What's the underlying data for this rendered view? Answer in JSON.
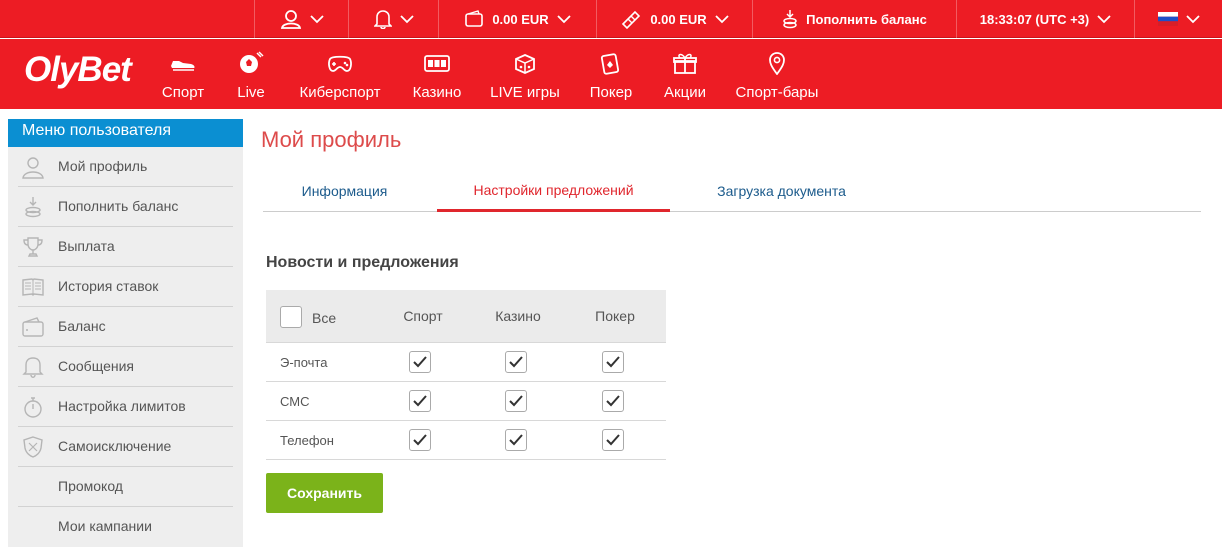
{
  "topbar": {
    "balance": "0.00 EUR",
    "bonus": "0.00 EUR",
    "deposit": "Пополнить баланс",
    "time": "18:33:07 (UTC +3)"
  },
  "brand": {
    "logo": "OlyBet",
    "accent": "#ed1c24"
  },
  "nav": [
    {
      "label": "Спорт",
      "icon": "sport-shoe-icon"
    },
    {
      "label": "Live",
      "icon": "live-ball-icon"
    },
    {
      "label": "Киберспорт",
      "icon": "gamepad-icon"
    },
    {
      "label": "Казино",
      "icon": "slot-machine-icon"
    },
    {
      "label": "LIVE игры",
      "icon": "dice-icon"
    },
    {
      "label": "Покер",
      "icon": "cards-icon"
    },
    {
      "label": "Акции",
      "icon": "gift-icon"
    },
    {
      "label": "Спорт-бары",
      "icon": "location-pin-icon"
    }
  ],
  "sidebar": {
    "title": "Меню пользователя",
    "items": [
      {
        "label": "Мой профиль",
        "icon": "user-icon"
      },
      {
        "label": "Пополнить баланс",
        "icon": "coins-icon"
      },
      {
        "label": "Выплата",
        "icon": "trophy-icon"
      },
      {
        "label": "История ставок",
        "icon": "book-icon"
      },
      {
        "label": "Баланс",
        "icon": "wallet-icon"
      },
      {
        "label": "Сообщения",
        "icon": "bell-icon"
      },
      {
        "label": "Настройка лимитов",
        "icon": "stopwatch-icon"
      },
      {
        "label": "Самоисключение",
        "icon": "shield-icon"
      },
      {
        "label": "Промокод",
        "icon": ""
      },
      {
        "label": "Мои кампании",
        "icon": ""
      }
    ]
  },
  "main": {
    "title": "Мой профиль",
    "tabs": [
      {
        "label": "Информация",
        "active": false
      },
      {
        "label": "Настройки предложений",
        "active": true
      },
      {
        "label": "Загрузка документа",
        "active": false
      }
    ],
    "section_title": "Новости и предложения",
    "table": {
      "all_label": "Все",
      "all_checked": false,
      "columns": [
        "Спорт",
        "Казино",
        "Покер"
      ],
      "rows": [
        {
          "label": "Э-почта",
          "checked": [
            true,
            true,
            true
          ]
        },
        {
          "label": "СМС",
          "checked": [
            true,
            true,
            true
          ]
        },
        {
          "label": "Телефон",
          "checked": [
            true,
            true,
            true
          ]
        }
      ]
    },
    "save_label": "Сохранить"
  }
}
